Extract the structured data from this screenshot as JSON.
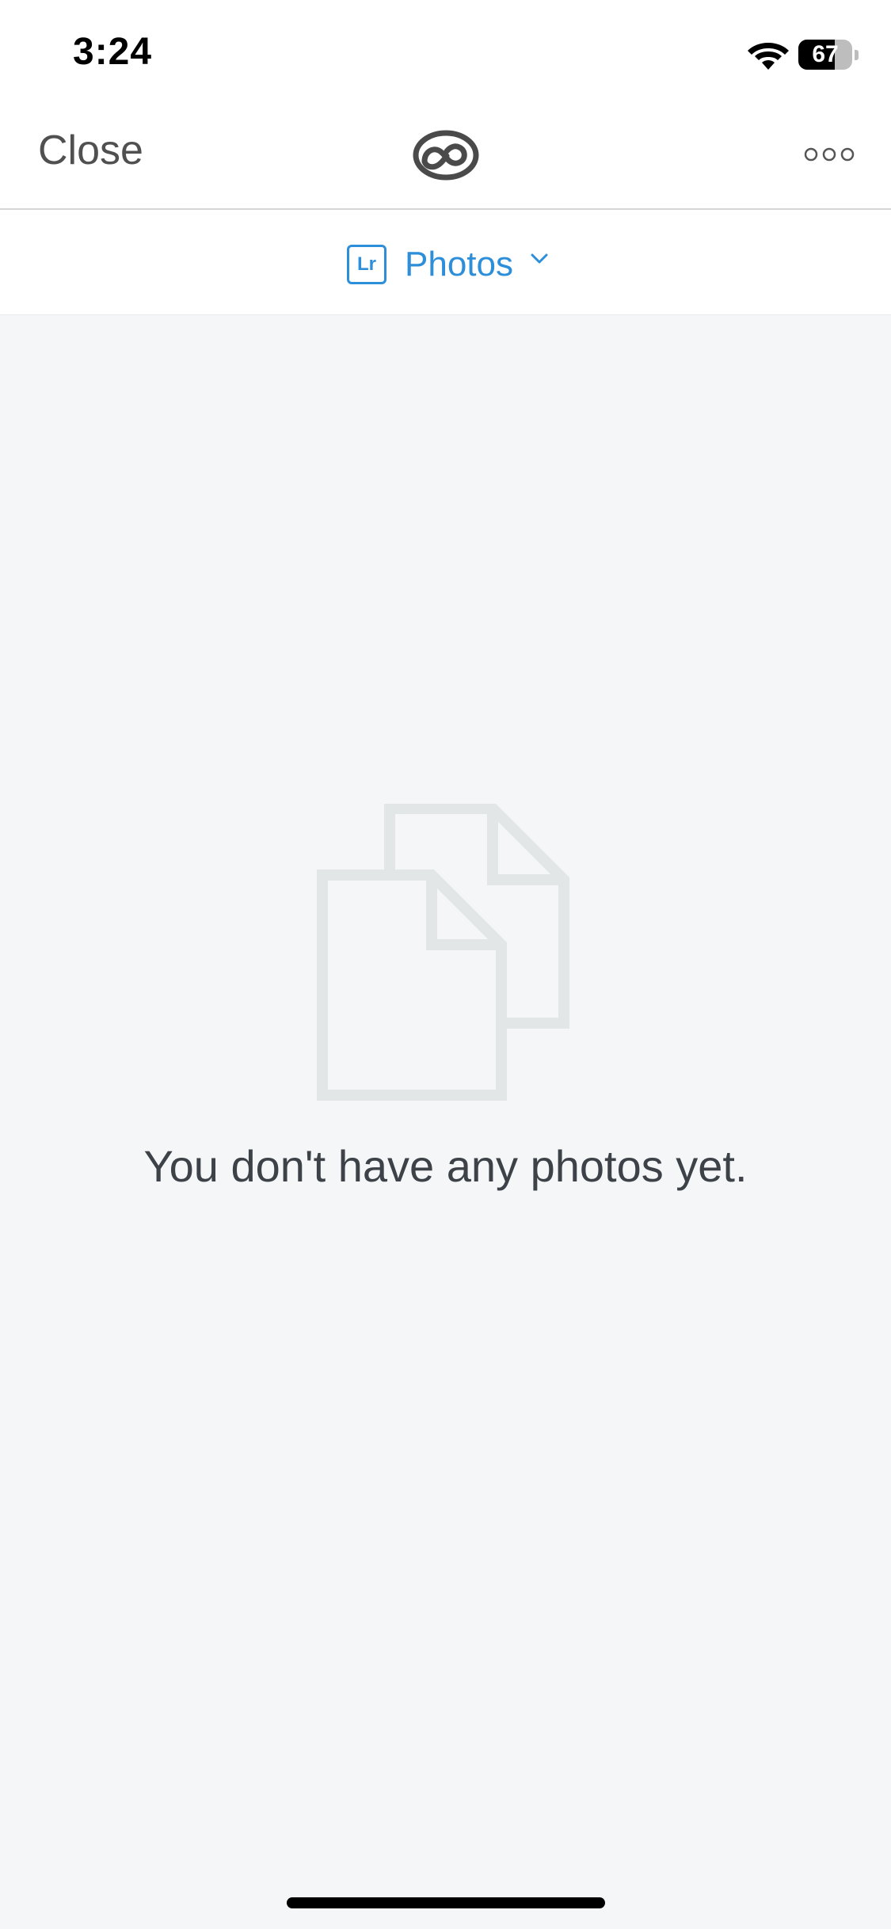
{
  "status_bar": {
    "time": "3:24",
    "battery_level": "67",
    "battery_fraction": 0.67
  },
  "nav": {
    "close_label": "Close",
    "logo_icon": "creative-cloud-icon",
    "more_icon": "more-dots-icon"
  },
  "switcher": {
    "badge": "Lr",
    "label": "Photos",
    "chevron_icon": "chevron-down-icon",
    "accent_color": "#2d8ed9"
  },
  "empty_state": {
    "icon": "documents-icon",
    "message": "You don't have any photos yet."
  },
  "colors": {
    "background": "#f4f6f8",
    "header_background": "#ffffff",
    "text_dark": "#3c4248",
    "illustration": "#e2e6e7"
  }
}
